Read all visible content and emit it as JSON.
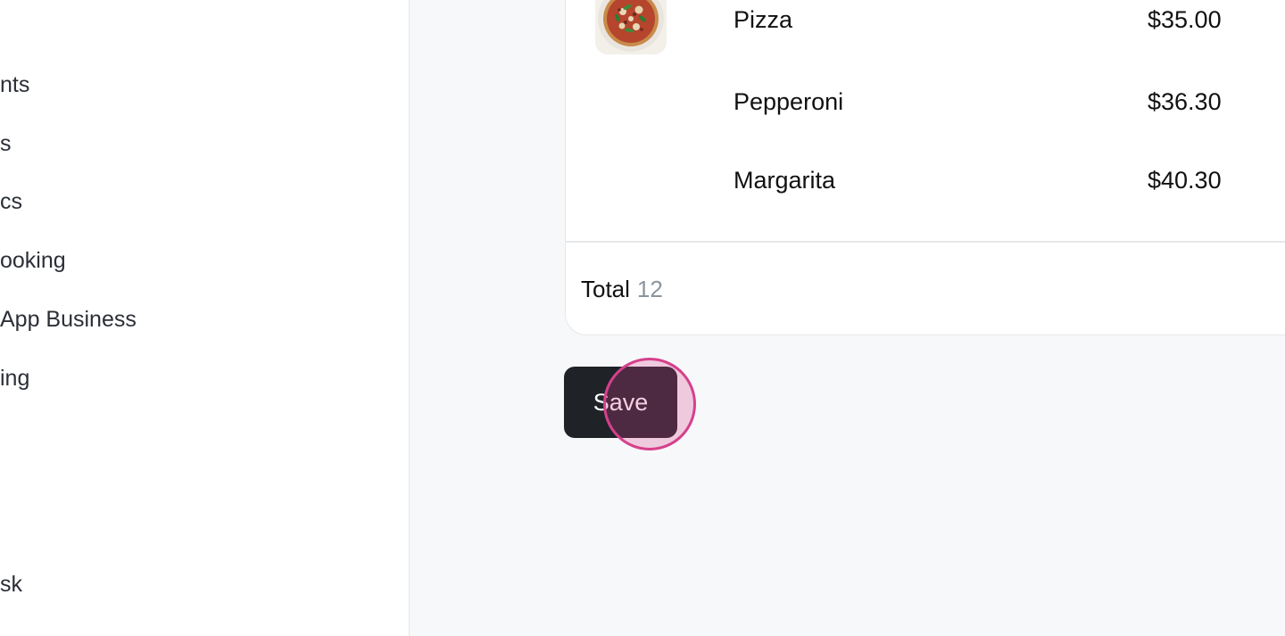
{
  "sidebar": {
    "items": [
      {
        "label": "nts"
      },
      {
        "label": "s"
      },
      {
        "label": "cs"
      },
      {
        "label": "ooking"
      },
      {
        "label": "App Business"
      },
      {
        "label": "ing"
      },
      {
        "label": "sk"
      }
    ]
  },
  "order": {
    "items": [
      {
        "name": "Pizza",
        "price": "$35.00"
      },
      {
        "name": "Pepperoni",
        "price": "$36.30"
      },
      {
        "name": "Margarita",
        "price": "$40.30"
      }
    ],
    "total_label": "Total",
    "total_count": "12"
  },
  "actions": {
    "save_label": "Save"
  },
  "colors": {
    "button_bg": "#1f2328",
    "click_indicator": "#d6408c",
    "muted_text": "#8b949e"
  },
  "icons": {
    "pizza_thumbnail": "pizza-image"
  }
}
